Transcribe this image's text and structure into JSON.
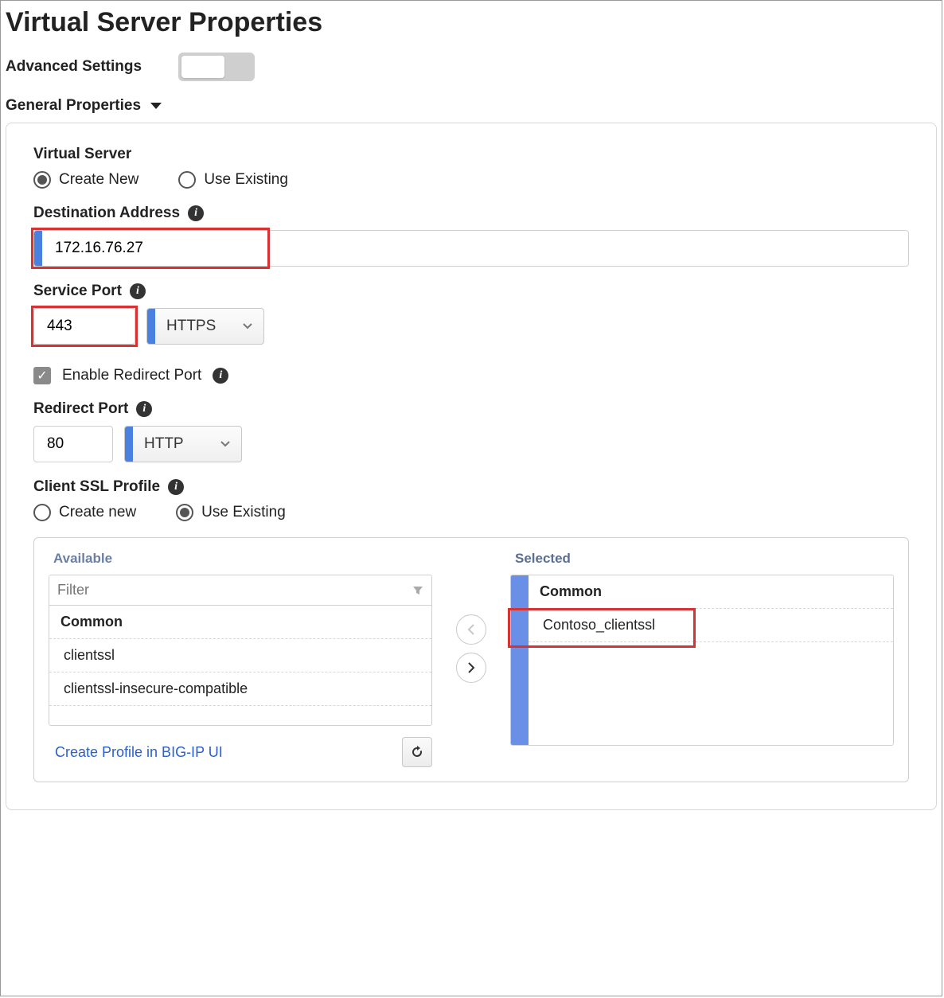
{
  "title": "Virtual Server Properties",
  "advanced_label": "Advanced Settings",
  "section_header": "General Properties",
  "virtual_server": {
    "label": "Virtual Server",
    "opt_create": "Create New",
    "opt_existing": "Use Existing"
  },
  "dest_addr": {
    "label": "Destination Address",
    "value": "172.16.76.27"
  },
  "service_port": {
    "label": "Service Port",
    "value": "443",
    "protocol": "HTTPS"
  },
  "enable_redirect": {
    "label": "Enable Redirect Port"
  },
  "redirect_port": {
    "label": "Redirect Port",
    "value": "80",
    "protocol": "HTTP"
  },
  "client_ssl": {
    "label": "Client SSL Profile",
    "opt_create": "Create new",
    "opt_existing": "Use Existing"
  },
  "dual_list": {
    "available_label": "Available",
    "selected_label": "Selected",
    "filter_placeholder": "Filter",
    "group": "Common",
    "available_items": {
      "i0": "clientssl",
      "i1": "clientssl-insecure-compatible"
    },
    "selected_items": {
      "i0": "Contoso_clientssl"
    },
    "create_link": "Create Profile in BIG-IP UI"
  }
}
